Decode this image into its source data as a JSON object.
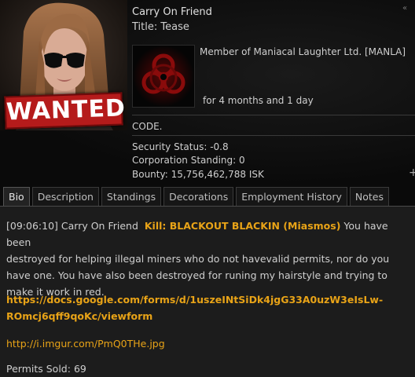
{
  "character": {
    "name": "Carry On Friend",
    "title": "Title: Tease",
    "wanted_label": "WANTED"
  },
  "corporation": {
    "member_text": "Member of Maniacal Laughter Ltd. [MANLA]",
    "duration_text": "for 4 months and 1 day"
  },
  "code_text": "CODE.",
  "stats": {
    "security_status": "Security Status: -0.8",
    "corp_standing": "Corporation Standing: 0",
    "bounty": "Bounty: 15,756,462,788 ISK"
  },
  "tabs": [
    {
      "label": "Bio",
      "active": true
    },
    {
      "label": "Description",
      "active": false
    },
    {
      "label": "Standings",
      "active": false
    },
    {
      "label": "Decorations",
      "active": false
    },
    {
      "label": "Employment History",
      "active": false
    },
    {
      "label": "Notes",
      "active": false
    }
  ],
  "bio": {
    "timestamp": "[09:06:10]",
    "speaker": "Carry On Friend",
    "kill_text": "Kill: BLACKOUT BLACKIN (Miasmos)",
    "message_line1": "You have been",
    "message_rest_l2": "destroyed for helping illegal miners who do not havevalid permits, nor do you",
    "message_rest_l3": "have one. You have also been destroyed for runing my hairstyle and trying to",
    "message_rest_l4": "make it work in red.",
    "link1_l1": "https://docs.google.com/forms/d/1uszeINtSiDk4jgG33A0uzW3eIsLw-",
    "link1_l2": "ROmcj6qff9qoKc/viewform",
    "link2": "http://i.imgur.com/PmQ0THe.jpg",
    "permits_label": "Permits Sold:",
    "permits_value": "69"
  },
  "icons": {
    "corner": "collapse-icon",
    "add": "plus-icon",
    "corp_logo": "biohazard-icon"
  },
  "colors": {
    "accent": "#e8a317",
    "wanted_bg": "#b51b1b",
    "logo_red": "#8a0b0b"
  }
}
